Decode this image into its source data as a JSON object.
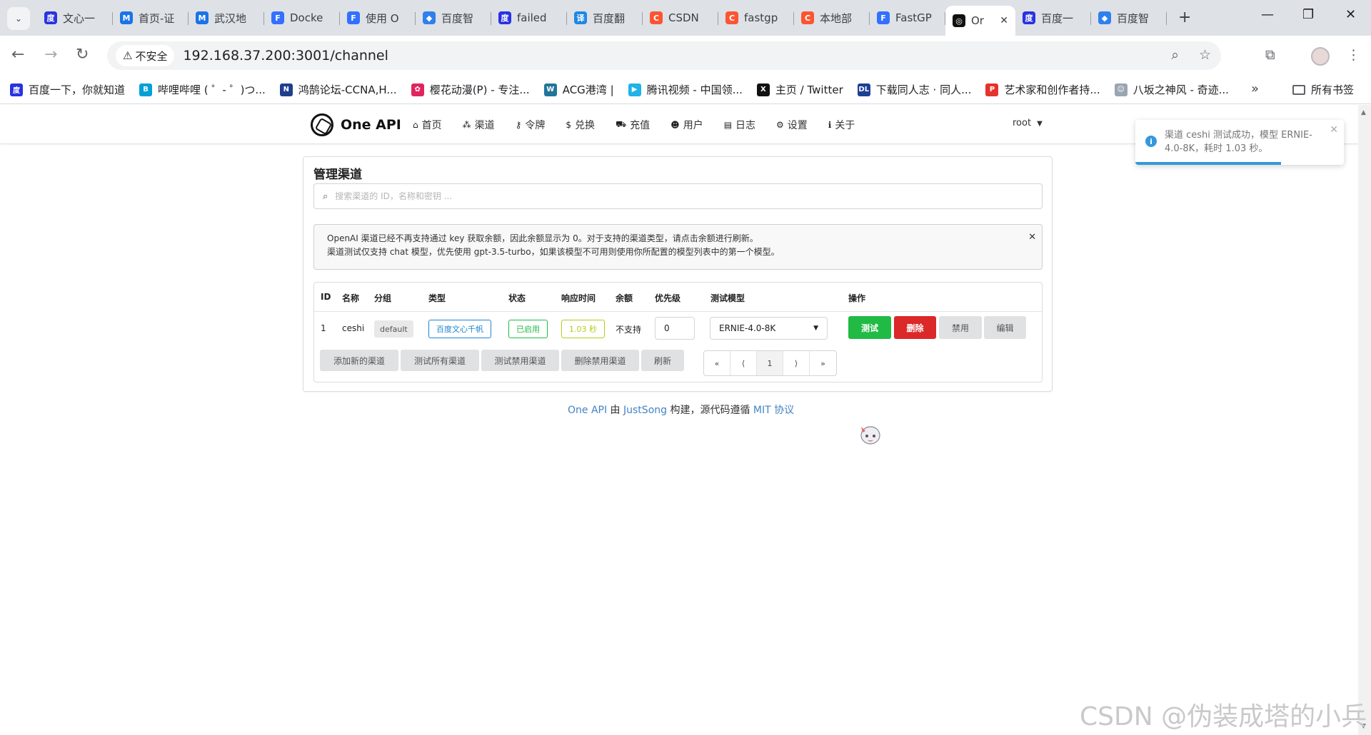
{
  "browser": {
    "tabs": [
      {
        "label": "文心一",
        "icon_color": "#2932e1",
        "icon_glyph": "度"
      },
      {
        "label": "首页-证",
        "icon_color": "#1a73e8",
        "icon_glyph": "M"
      },
      {
        "label": "武汉地",
        "icon_color": "#1a73e8",
        "icon_glyph": "M"
      },
      {
        "label": "Docke",
        "icon_color": "#3370ff",
        "icon_glyph": "F"
      },
      {
        "label": "使用 O",
        "icon_color": "#3370ff",
        "icon_glyph": "F"
      },
      {
        "label": "百度智",
        "icon_color": "#2f80ed",
        "icon_glyph": "◆"
      },
      {
        "label": "failed",
        "icon_color": "#2932e1",
        "icon_glyph": "度"
      },
      {
        "label": "百度翻",
        "icon_color": "#1e88e5",
        "icon_glyph": "译"
      },
      {
        "label": "CSDN",
        "icon_color": "#fc5531",
        "icon_glyph": "C"
      },
      {
        "label": "fastgp",
        "icon_color": "#fc5531",
        "icon_glyph": "C"
      },
      {
        "label": "本地部",
        "icon_color": "#fc5531",
        "icon_glyph": "C"
      },
      {
        "label": "FastGP",
        "icon_color": "#3370ff",
        "icon_glyph": "F"
      },
      {
        "label": "Or",
        "icon_color": "#111111",
        "icon_glyph": "◎",
        "active": true
      },
      {
        "label": "百度一",
        "icon_color": "#2932e1",
        "icon_glyph": "度"
      },
      {
        "label": "百度智",
        "icon_color": "#2f80ed",
        "icon_glyph": "◆"
      }
    ],
    "insecure_label": "不安全",
    "url": "192.168.37.200:3001/channel",
    "bookmarks": [
      {
        "label": "百度一下，你就知道",
        "icon_color": "#2932e1",
        "icon_glyph": "度"
      },
      {
        "label": "哔哩哔哩 ( ゜- ゜)つ...",
        "icon_color": "#00a1d6",
        "icon_glyph": "B"
      },
      {
        "label": "鸿鹄论坛-CCNA,H...",
        "icon_color": "#1f3f8c",
        "icon_glyph": "N"
      },
      {
        "label": "樱花动漫(P) - 专注...",
        "icon_color": "#e0245e",
        "icon_glyph": "✿"
      },
      {
        "label": "ACG港湾 |",
        "icon_color": "#21759b",
        "icon_glyph": "W"
      },
      {
        "label": "腾讯视频 - 中国领...",
        "icon_color": "#20b2e8",
        "icon_glyph": "▶"
      },
      {
        "label": "主页 / Twitter",
        "icon_color": "#111111",
        "icon_glyph": "X"
      },
      {
        "label": "下载同人志 · 同人...",
        "icon_color": "#1c3f94",
        "icon_glyph": "DL"
      },
      {
        "label": "艺术家和创作者持...",
        "icon_color": "#e5322d",
        "icon_glyph": "P"
      },
      {
        "label": "八坂之神风 - 奇迹...",
        "icon_color": "#9aa5b1",
        "icon_glyph": "☺"
      }
    ],
    "all_bookmarks_label": "所有书签"
  },
  "app": {
    "brand": "One API",
    "menu": [
      {
        "icon": "⌂",
        "label": "首页",
        "name": "home"
      },
      {
        "icon": "⁂",
        "label": "渠道",
        "name": "channel"
      },
      {
        "icon": "⚷",
        "label": "令牌",
        "name": "token"
      },
      {
        "icon": "$",
        "label": "兑换",
        "name": "redeem"
      },
      {
        "icon": "⛟",
        "label": "充值",
        "name": "topup"
      },
      {
        "icon": "☻",
        "label": "用户",
        "name": "user"
      },
      {
        "icon": "▤",
        "label": "日志",
        "name": "log"
      },
      {
        "icon": "⚙",
        "label": "设置",
        "name": "setting"
      },
      {
        "icon": "ℹ",
        "label": "关于",
        "name": "about"
      }
    ],
    "user": "root"
  },
  "toast": {
    "message": "渠道 ceshi 测试成功，模型 ERNIE-4.0-8K，耗时 1.03 秒。",
    "progress": 0.7,
    "color": "#3498db"
  },
  "card": {
    "title": "管理渠道",
    "search_placeholder": "搜索渠道的 ID，名称和密钥 ...",
    "notice_line1": "OpenAI 渠道已经不再支持通过 key 获取余额，因此余额显示为 0。对于支持的渠道类型，请点击余额进行刷新。",
    "notice_line2": "渠道测试仅支持 chat 模型，优先使用 gpt-3.5-turbo，如果该模型不可用则使用你所配置的模型列表中的第一个模型。"
  },
  "table": {
    "headers": [
      "ID",
      "名称",
      "分组",
      "类型",
      "状态",
      "响应时间",
      "余额",
      "优先级",
      "测试模型",
      "操作"
    ],
    "row": {
      "id": "1",
      "name": "ceshi",
      "group": "default",
      "type": "百度文心千帆",
      "status": "已启用",
      "response_time": "1.03 秒",
      "balance": "不支持",
      "priority": "0",
      "test_model": "ERNIE-4.0-8K",
      "actions": [
        "测试",
        "删除",
        "禁用",
        "编辑"
      ]
    },
    "footer_buttons": [
      "添加新的渠道",
      "测试所有渠道",
      "测试禁用渠道",
      "删除禁用渠道",
      "刷新"
    ],
    "pager": [
      "«",
      "⟨",
      "1",
      "⟩",
      "»"
    ],
    "current_page": "1"
  },
  "footer": {
    "link1": "One API",
    "text1": " 由 ",
    "link2": "JustSong",
    "text2": " 构建，源代码遵循 ",
    "link3": "MIT 协议"
  },
  "colors": {
    "green": "#21ba45",
    "red": "#db2828",
    "blue": "#2185d0",
    "olive": "#b5cc18",
    "link": "#4183c4"
  },
  "watermark": "CSDN @伪装成塔的小兵"
}
